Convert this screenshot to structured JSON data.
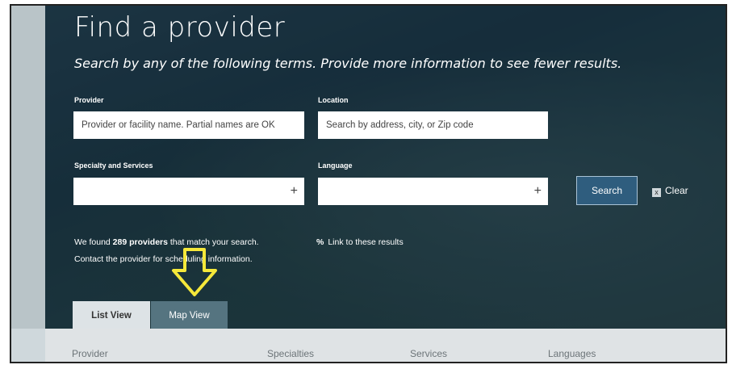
{
  "page": {
    "title": "Find a provider",
    "subtitle": "Search by any of the following terms. Provide more information to see fewer results."
  },
  "form": {
    "provider_label": "Provider",
    "provider_placeholder": "Provider or facility name. Partial names are OK",
    "location_label": "Location",
    "location_placeholder": "Search by address, city, or Zip code",
    "specialty_label": "Specialty and Services",
    "language_label": "Language",
    "plus": "+",
    "search_label": "Search",
    "clear_label": "Clear",
    "clear_icon": "x"
  },
  "results": {
    "prefix": "We found ",
    "count_text": "289 providers",
    "suffix": " that match your search.",
    "line2": "Contact the provider for scheduling information.",
    "link_label": "Link to these results",
    "link_icon": "%"
  },
  "tabs": [
    {
      "label": "List View",
      "active": true
    },
    {
      "label": "Map View",
      "active": false
    }
  ],
  "table": {
    "columns": [
      "Provider",
      "Specialties",
      "Services",
      "Languages"
    ]
  },
  "annotation": {
    "icon": "down-arrow-icon",
    "color": "#f5e83a"
  },
  "colors": {
    "search_button": "#2f5d7e",
    "tab_active_bg": "#dde3e6",
    "tab_inactive_bg": "#557480"
  }
}
